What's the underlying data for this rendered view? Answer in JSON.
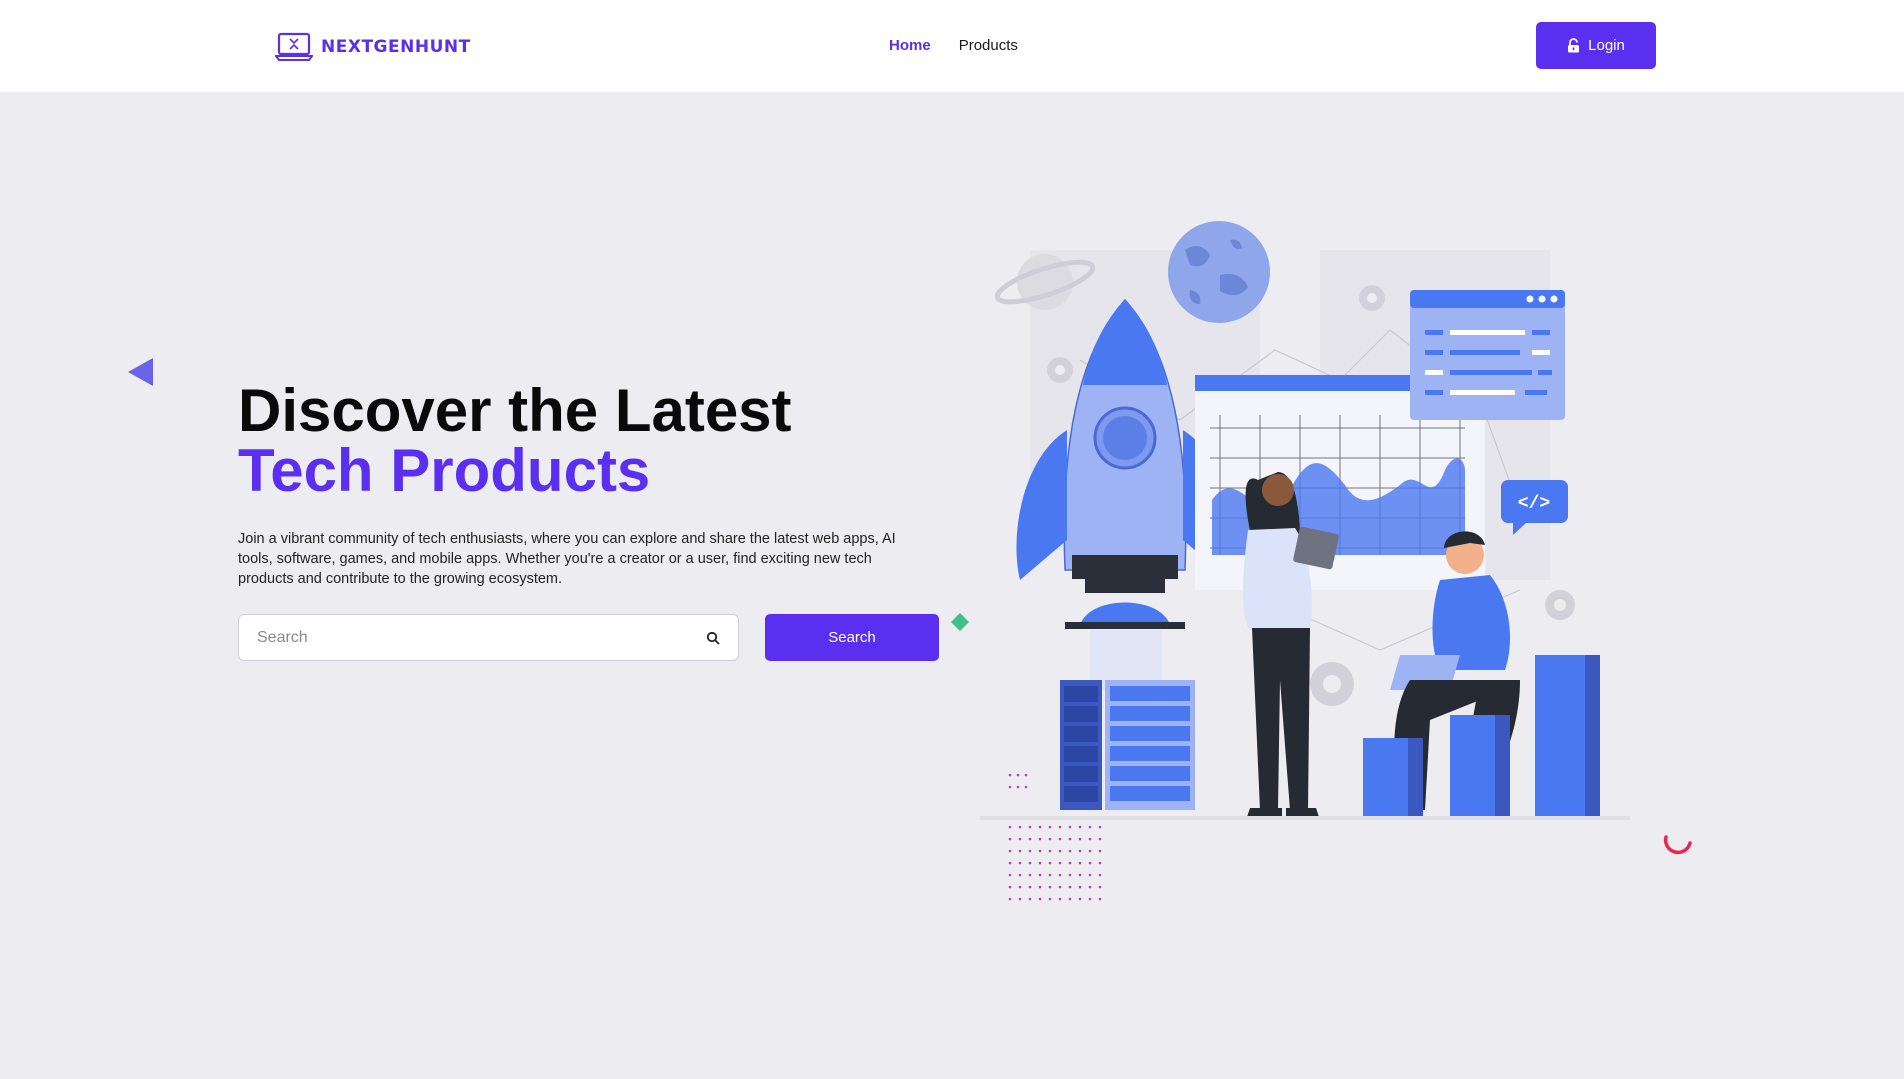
{
  "brand": {
    "name": "NEXTGENHUNT",
    "color": "#5b30e6"
  },
  "nav": {
    "items": [
      {
        "label": "Home",
        "active": true
      },
      {
        "label": "Products",
        "active": false
      }
    ]
  },
  "header": {
    "login_label": "Login",
    "login_icon": "unlock-icon"
  },
  "hero": {
    "title_line1": "Discover the Latest",
    "title_line2": "Tech Products",
    "description": "Join a vibrant community of tech enthusiasts, where you can explore and share the latest web apps, AI tools, software, games, and mobile apps. Whether you're a creator or a user, find exciting new tech products and contribute to the growing ecosystem.",
    "search_placeholder": "Search",
    "search_button": "Search",
    "illustration_code_tag": "</>"
  },
  "colors": {
    "accent": "#5b2ff0",
    "background": "#edecf1",
    "illustration_blue": "#4a78f0",
    "decor_green": "#3fc08a",
    "decor_red": "#e8264f"
  }
}
